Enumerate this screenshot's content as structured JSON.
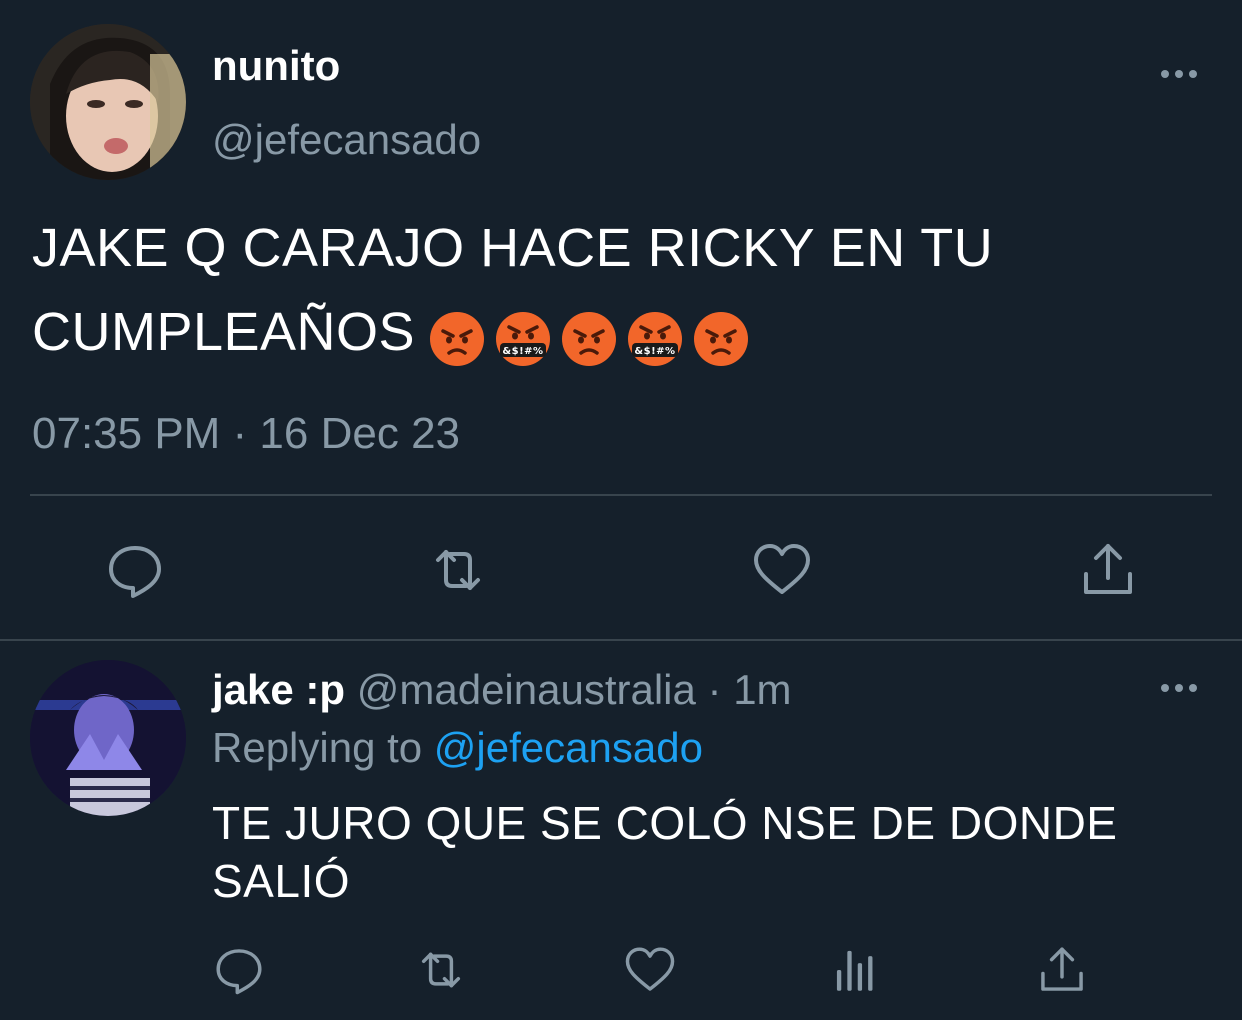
{
  "main_tweet": {
    "display_name": "nunito",
    "handle": "@jefecansado",
    "text": "JAKE Q CARAJO HACE RICKY EN TU CUMPLEAÑOS",
    "emojis": [
      "pouting-face",
      "face-with-symbols",
      "pouting-face",
      "face-with-symbols",
      "pouting-face"
    ],
    "timestamp": "07:35 PM · 16 Dec 23",
    "actions": [
      "reply-icon",
      "retweet-icon",
      "like-icon",
      "share-icon"
    ]
  },
  "reply": {
    "display_name": "jake :p",
    "handle": "@madeinaustralia",
    "separator": " · ",
    "time": "1m",
    "replying_prefix": "Replying to",
    "replying_handle": "@jefecansado",
    "text": "TE JURO QUE SE COLÓ NSE DE DONDE SALIÓ",
    "actions": [
      "reply-icon",
      "retweet-icon",
      "like-icon",
      "analytics-icon",
      "share-icon"
    ]
  },
  "colors": {
    "background": "#15202b",
    "secondary_text": "#8899a6",
    "accent": "#1da1f2",
    "divider": "#38444d"
  }
}
